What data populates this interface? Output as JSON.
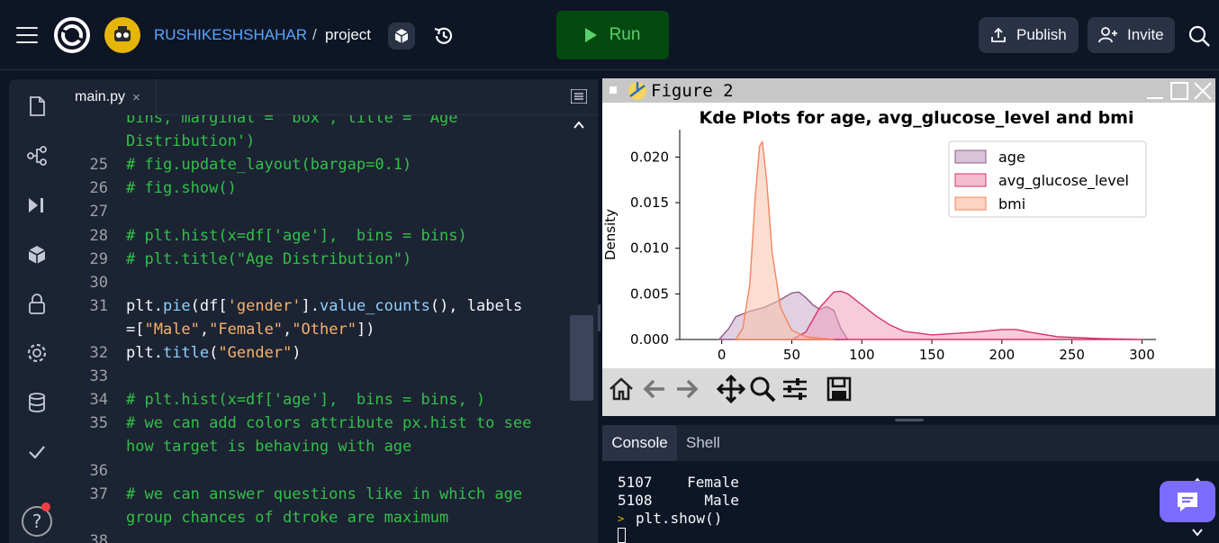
{
  "header": {
    "owner": "RUSHIKESHSHAHAR",
    "separator": "/",
    "project": "project",
    "run_label": "Run",
    "publish_label": "Publish",
    "invite_label": "Invite"
  },
  "editor": {
    "tab_name": "main.py",
    "tab_close": "×",
    "lines": [
      {
        "n": "",
        "parts": [
          {
            "c": "cm",
            "t": "bins, marginal = 'box', title = 'Age"
          }
        ]
      },
      {
        "n": "",
        "parts": [
          {
            "c": "cm",
            "t": "Distribution')"
          }
        ]
      },
      {
        "n": "25",
        "parts": [
          {
            "c": "cm",
            "t": "# fig.update_layout(bargap=0.1)"
          }
        ]
      },
      {
        "n": "26",
        "parts": [
          {
            "c": "cm",
            "t": "# fig.show()"
          }
        ]
      },
      {
        "n": "27",
        "parts": []
      },
      {
        "n": "28",
        "parts": [
          {
            "c": "cm",
            "t": "# plt.hist(x=df['age'],  bins = bins)"
          }
        ]
      },
      {
        "n": "29",
        "parts": [
          {
            "c": "cm",
            "t": "# plt.title(\"Age Distribution\")"
          }
        ]
      },
      {
        "n": "30",
        "parts": []
      },
      {
        "n": "31",
        "parts": [
          {
            "c": "tx",
            "t": "plt."
          },
          {
            "c": "fn",
            "t": "pie"
          },
          {
            "c": "tx",
            "t": "(df["
          },
          {
            "c": "st",
            "t": "'gender'"
          },
          {
            "c": "tx",
            "t": "]."
          },
          {
            "c": "fn",
            "t": "value_counts"
          },
          {
            "c": "tx",
            "t": "(), labels"
          }
        ]
      },
      {
        "n": "",
        "parts": [
          {
            "c": "tx",
            "t": "=["
          },
          {
            "c": "st",
            "t": "\"Male\""
          },
          {
            "c": "tx",
            "t": ","
          },
          {
            "c": "st",
            "t": "\"Female\""
          },
          {
            "c": "tx",
            "t": ","
          },
          {
            "c": "st",
            "t": "\"Other\""
          },
          {
            "c": "tx",
            "t": "])"
          }
        ]
      },
      {
        "n": "32",
        "parts": [
          {
            "c": "tx",
            "t": "plt."
          },
          {
            "c": "fn",
            "t": "title"
          },
          {
            "c": "tx",
            "t": "("
          },
          {
            "c": "st",
            "t": "\"Gender\""
          },
          {
            "c": "tx",
            "t": ")"
          }
        ]
      },
      {
        "n": "33",
        "parts": []
      },
      {
        "n": "34",
        "parts": [
          {
            "c": "cm",
            "t": "# plt.hist(x=df['age'],  bins = bins, )"
          }
        ]
      },
      {
        "n": "35",
        "parts": [
          {
            "c": "cm",
            "t": "# we can add colors attribute px.hist to see"
          }
        ]
      },
      {
        "n": "",
        "parts": [
          {
            "c": "cm",
            "t": "how target is behaving with age"
          }
        ]
      },
      {
        "n": "36",
        "parts": []
      },
      {
        "n": "37",
        "parts": [
          {
            "c": "cm",
            "t": "# we can answer questions like in which age"
          }
        ]
      },
      {
        "n": "",
        "parts": [
          {
            "c": "cm",
            "t": "group chances of dtroke are maximum"
          }
        ]
      },
      {
        "n": "38",
        "parts": []
      }
    ]
  },
  "figure": {
    "window_title": "Figure 2"
  },
  "chart_data": {
    "type": "area",
    "title": "Kde Plots for age, avg_glucose_level and bmi",
    "xlabel": "",
    "ylabel": "Density",
    "xlim": [
      -30,
      310
    ],
    "ylim": [
      0,
      0.023
    ],
    "xticks": [
      0,
      50,
      100,
      150,
      200,
      250,
      300
    ],
    "yticks": [
      0.0,
      0.005,
      0.01,
      0.015,
      0.02
    ],
    "ytick_labels": [
      "0.000",
      "0.005",
      "0.010",
      "0.015",
      "0.020"
    ],
    "legend_position": "top-right",
    "series": [
      {
        "name": "age",
        "color": "#8e5a8a",
        "fill": "#c9a9c4",
        "x": [
          -2,
          5,
          10,
          20,
          30,
          40,
          50,
          55,
          60,
          65,
          70,
          75,
          80,
          85,
          90
        ],
        "y": [
          0,
          0.0012,
          0.0025,
          0.0031,
          0.0035,
          0.0042,
          0.0051,
          0.0052,
          0.0046,
          0.0038,
          0.0033,
          0.0036,
          0.0032,
          0.0012,
          0
        ]
      },
      {
        "name": "avg_glucose_level",
        "color": "#d6336c",
        "fill": "#eea0bb",
        "x": [
          50,
          60,
          70,
          80,
          85,
          90,
          100,
          110,
          120,
          130,
          150,
          180,
          200,
          210,
          220,
          240,
          270,
          300
        ],
        "y": [
          0,
          0.0008,
          0.0035,
          0.0052,
          0.0053,
          0.005,
          0.0038,
          0.0026,
          0.0016,
          0.0009,
          0.0005,
          0.0008,
          0.0011,
          0.0011,
          0.0008,
          0.0003,
          0.0001,
          0
        ]
      },
      {
        "name": "bmi",
        "color": "#f4845f",
        "fill": "#f9c2ab",
        "x": [
          10,
          15,
          20,
          24,
          27,
          29,
          32,
          36,
          42,
          50,
          60,
          80
        ],
        "y": [
          0,
          0.0012,
          0.006,
          0.0158,
          0.0212,
          0.0217,
          0.0175,
          0.0095,
          0.0035,
          0.001,
          0.0003,
          0
        ]
      }
    ]
  },
  "console": {
    "tab_console": "Console",
    "tab_shell": "Shell",
    "lines": [
      "5107    Female",
      "5108      Male"
    ],
    "prompt": ">",
    "command": "plt.show()"
  }
}
